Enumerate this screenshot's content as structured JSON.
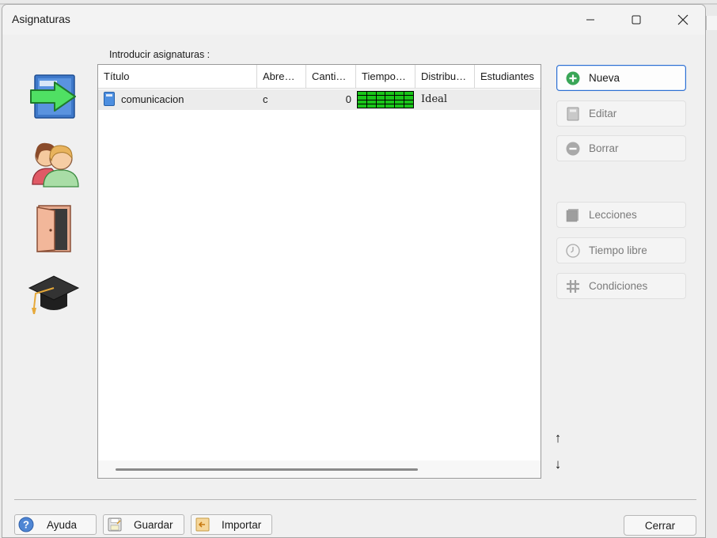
{
  "window": {
    "title": "Asignaturas"
  },
  "list": {
    "caption": "Introducir asignaturas :",
    "columns": [
      "Título",
      "Abre…",
      "Canti…",
      "Tiempo…",
      "Distribu…",
      "Estudiantes"
    ],
    "rows": [
      {
        "title": "comunicacion",
        "abbreviation": "c",
        "quantity": "0",
        "time_icon": "green-availability-grid-icon",
        "distribution": "Ideal",
        "students": ""
      }
    ]
  },
  "actions": {
    "new_label": "Nueva",
    "edit_label": "Editar",
    "delete_label": "Borrar",
    "lessons_label": "Lecciones",
    "free_time_label": "Tiempo libre",
    "conditions_label": "Condiciones",
    "move_up": "↑",
    "move_down": "↓"
  },
  "footer": {
    "help_label": "Ayuda",
    "save_label": "Guardar",
    "import_label": "Importar",
    "close_label": "Cerrar"
  },
  "colors": {
    "accent": "#2d6fd1",
    "new_icon_green": "#3aa657",
    "time_grid_green": "#19c519"
  }
}
